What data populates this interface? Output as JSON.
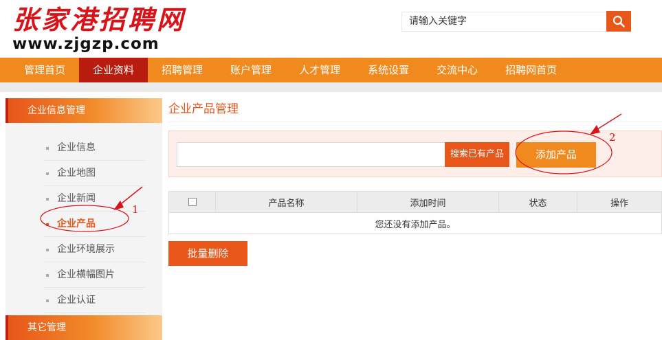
{
  "header": {
    "logo_cn": "张家港招聘网",
    "logo_url": "www.zjgzp.com",
    "search_placeholder": "请输入关键字"
  },
  "nav": {
    "items": [
      {
        "label": "管理首页"
      },
      {
        "label": "企业资料"
      },
      {
        "label": "招聘管理"
      },
      {
        "label": "账户管理"
      },
      {
        "label": "人才管理"
      },
      {
        "label": "系统设置"
      },
      {
        "label": "交流中心"
      },
      {
        "label": "招聘网首页"
      }
    ],
    "active": "企业资料"
  },
  "sidebar": {
    "section1": "企业信息管理",
    "items": [
      {
        "label": "企业信息"
      },
      {
        "label": "企业地图"
      },
      {
        "label": "企业新闻"
      },
      {
        "label": "企业产品"
      },
      {
        "label": "企业环境展示"
      },
      {
        "label": "企业横幅图片"
      },
      {
        "label": "企业认证"
      }
    ],
    "active": "企业产品",
    "section2": "其它管理"
  },
  "main": {
    "title": "企业产品管理",
    "search_button": "搜索已有产品",
    "add_button": "添加产品",
    "table": {
      "headers": [
        "产品名称",
        "添加时间",
        "状态",
        "操作"
      ],
      "empty_message": "您还没有添加产品。"
    },
    "batch_delete": "批量删除"
  },
  "annotations": {
    "marker1": "1",
    "marker2": "2"
  },
  "colors": {
    "brand_red": "#d8141b",
    "nav_orange": "#f08a1e",
    "nav_active": "#b71c0f",
    "accent_orange": "#e8561a"
  }
}
